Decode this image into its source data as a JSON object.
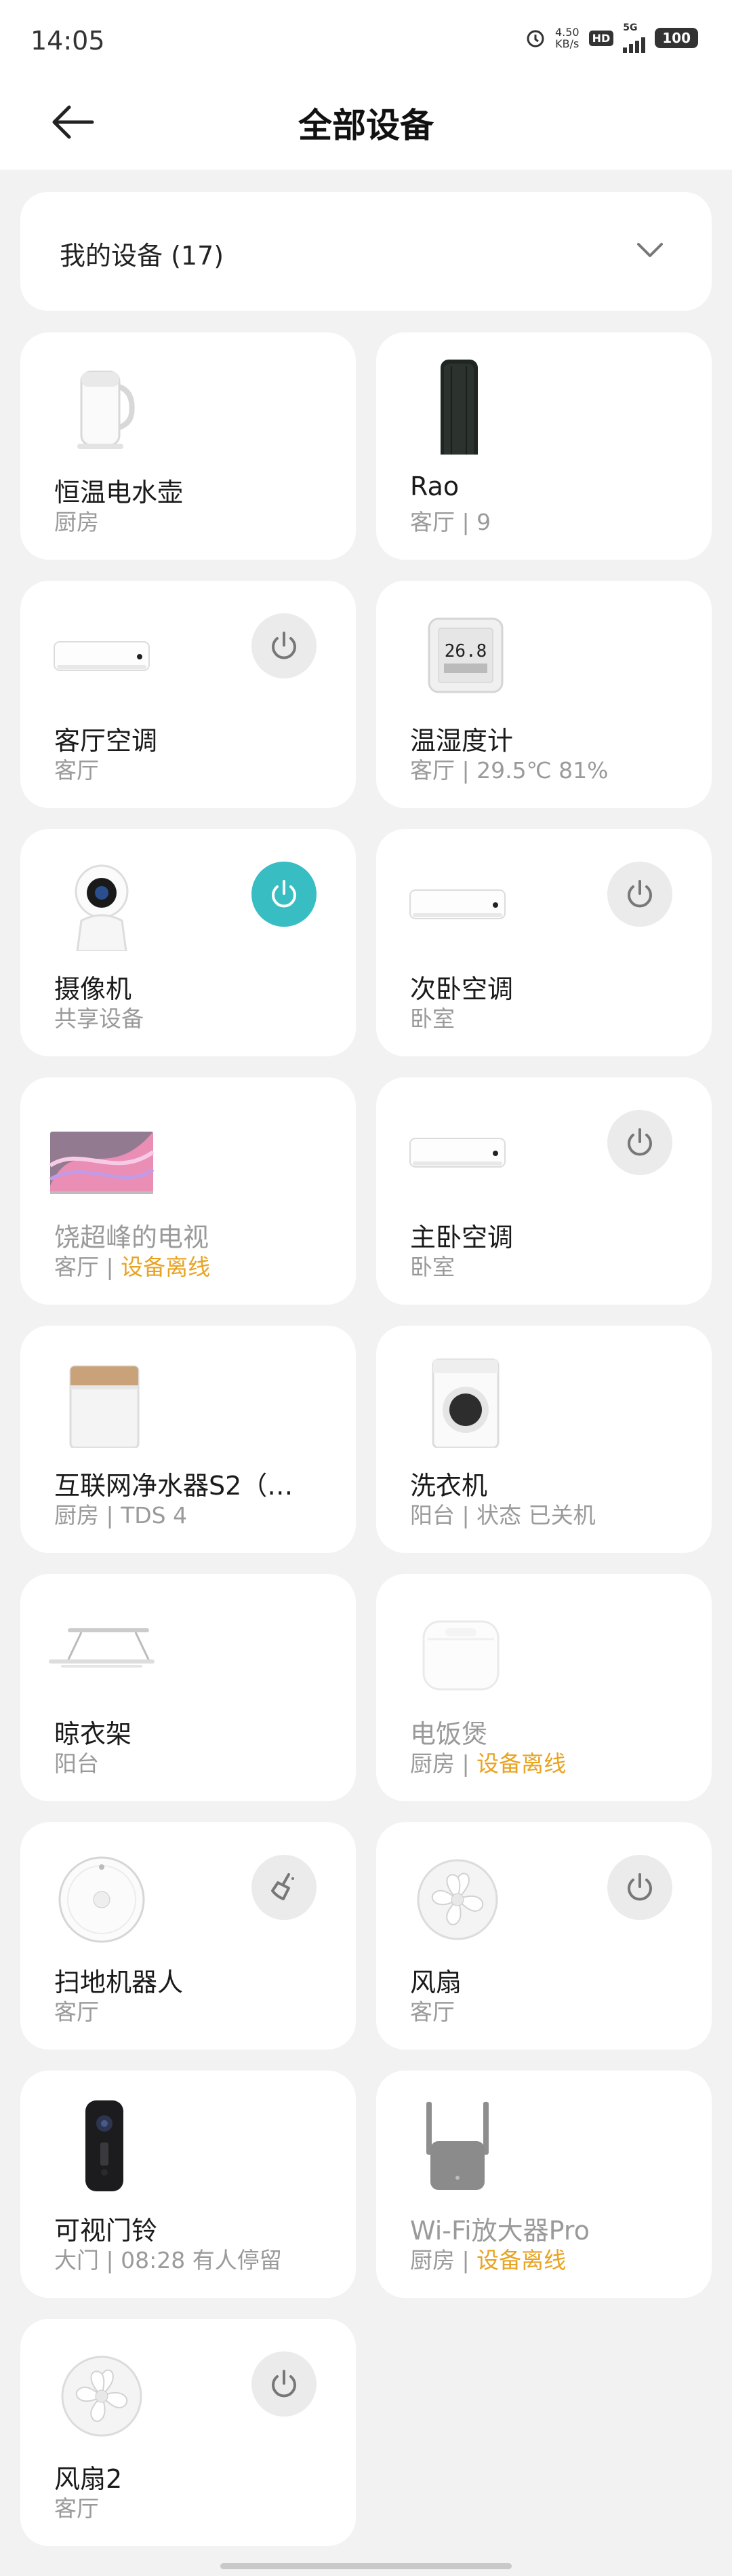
{
  "status": {
    "time": "14:05",
    "speed": "4.50",
    "speed_unit": "KB/s",
    "hd": "HD",
    "net": "5G",
    "battery": "100"
  },
  "header": {
    "title": "全部设备"
  },
  "group": {
    "label": "我的设备 (17)"
  },
  "devices": [
    {
      "name": "恒温电水壶",
      "room": "厨房",
      "detail": "",
      "offline": "",
      "icon": "kettle-icon",
      "power": ""
    },
    {
      "name": "Rao",
      "room": "客厅 | 9",
      "detail": "",
      "offline": "",
      "icon": "router-icon",
      "power": ""
    },
    {
      "name": "客厅空调",
      "room": "客厅",
      "detail": "",
      "offline": "",
      "icon": "air-conditioner-icon",
      "power": "off"
    },
    {
      "name": "温湿度计",
      "room": "客厅 | 29.5℃ 81%",
      "detail": "",
      "offline": "",
      "icon": "thermometer-icon",
      "power": "",
      "display": "26.8"
    },
    {
      "name": "摄像机",
      "room": "共享设备",
      "detail": "",
      "offline": "",
      "icon": "camera-icon",
      "power": "on"
    },
    {
      "name": "次卧空调",
      "room": "卧室",
      "detail": "",
      "offline": "",
      "icon": "air-conditioner-icon",
      "power": "off"
    },
    {
      "name": "饶超峰的电视",
      "room": "客厅 | ",
      "detail": "",
      "offline": "设备离线",
      "icon": "tv-icon",
      "power": ""
    },
    {
      "name": "主卧空调",
      "room": "卧室",
      "detail": "",
      "offline": "",
      "icon": "air-conditioner-icon",
      "power": "off"
    },
    {
      "name": "互联网净水器S2（…",
      "room": "厨房 | TDS 4",
      "detail": "",
      "offline": "",
      "icon": "water-purifier-icon",
      "power": ""
    },
    {
      "name": "洗衣机",
      "room": "阳台 | 状态 已关机",
      "detail": "",
      "offline": "",
      "icon": "washing-machine-icon",
      "power": ""
    },
    {
      "name": "晾衣架",
      "room": "阳台",
      "detail": "",
      "offline": "",
      "icon": "clothes-rack-icon",
      "power": ""
    },
    {
      "name": "电饭煲",
      "room": "厨房 | ",
      "detail": "",
      "offline": "设备离线",
      "icon": "rice-cooker-icon",
      "power": ""
    },
    {
      "name": "扫地机器人",
      "room": "客厅",
      "detail": "",
      "offline": "",
      "icon": "robot-vacuum-icon",
      "power": "clean"
    },
    {
      "name": "风扇",
      "room": "客厅",
      "detail": "",
      "offline": "",
      "icon": "fan-icon",
      "power": "off"
    },
    {
      "name": "可视门铃",
      "room": "大门 | 08:28 有人停留",
      "detail": "",
      "offline": "",
      "icon": "doorbell-icon",
      "power": ""
    },
    {
      "name": "Wi-Fi放大器Pro",
      "room": "厨房 | ",
      "detail": "",
      "offline": "设备离线",
      "icon": "wifi-extender-icon",
      "power": ""
    },
    {
      "name": "风扇2",
      "room": "客厅",
      "detail": "",
      "offline": "",
      "icon": "fan-icon",
      "power": "off"
    }
  ],
  "colors": {
    "accent": "#38bdc2",
    "offline": "#e9a321",
    "background": "#f2f2f2"
  }
}
